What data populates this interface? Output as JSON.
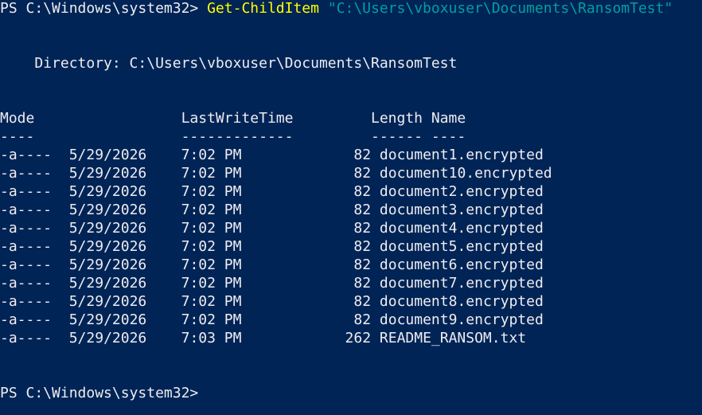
{
  "colors": {
    "background": "#012456",
    "foreground": "#eeedf0",
    "cmdlet": "#ffff00",
    "argument": "#00a0a0"
  },
  "command": {
    "prompt": "PS C:\\Windows\\system32> ",
    "cmdlet": "Get-ChildItem",
    "argument": " \"C:\\Users\\vboxuser\\Documents\\RansomTest\""
  },
  "directory_line": "    Directory: C:\\Users\\vboxuser\\Documents\\RansomTest",
  "table": {
    "header": "Mode                 LastWriteTime         Length Name",
    "separator": "----                 -------------         ------ ----",
    "rows": [
      {
        "mode": "-a----",
        "date": "5/29/2026",
        "time": "7:02 PM",
        "length": "82",
        "name": "document1.encrypted"
      },
      {
        "mode": "-a----",
        "date": "5/29/2026",
        "time": "7:02 PM",
        "length": "82",
        "name": "document10.encrypted"
      },
      {
        "mode": "-a----",
        "date": "5/29/2026",
        "time": "7:02 PM",
        "length": "82",
        "name": "document2.encrypted"
      },
      {
        "mode": "-a----",
        "date": "5/29/2026",
        "time": "7:02 PM",
        "length": "82",
        "name": "document3.encrypted"
      },
      {
        "mode": "-a----",
        "date": "5/29/2026",
        "time": "7:02 PM",
        "length": "82",
        "name": "document4.encrypted"
      },
      {
        "mode": "-a----",
        "date": "5/29/2026",
        "time": "7:02 PM",
        "length": "82",
        "name": "document5.encrypted"
      },
      {
        "mode": "-a----",
        "date": "5/29/2026",
        "time": "7:02 PM",
        "length": "82",
        "name": "document6.encrypted"
      },
      {
        "mode": "-a----",
        "date": "5/29/2026",
        "time": "7:02 PM",
        "length": "82",
        "name": "document7.encrypted"
      },
      {
        "mode": "-a----",
        "date": "5/29/2026",
        "time": "7:02 PM",
        "length": "82",
        "name": "document8.encrypted"
      },
      {
        "mode": "-a----",
        "date": "5/29/2026",
        "time": "7:02 PM",
        "length": "82",
        "name": "document9.encrypted"
      },
      {
        "mode": "-a----",
        "date": "5/29/2026",
        "time": "7:03 PM",
        "length": "262",
        "name": "README_RANSOM.txt"
      }
    ]
  },
  "final_prompt": "PS C:\\Windows\\system32> "
}
